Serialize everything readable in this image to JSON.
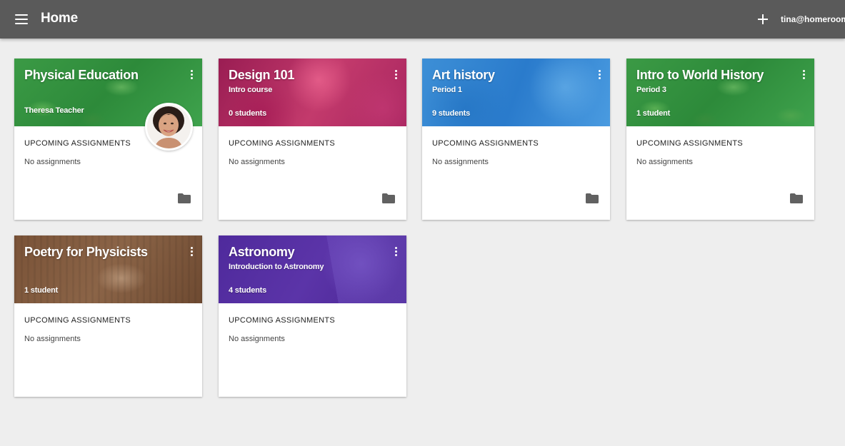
{
  "header": {
    "title": "Home",
    "user_email": "tina@homerooma",
    "menu_icon": "hamburger-menu-icon",
    "add_icon": "plus-icon"
  },
  "section_label": "UPCOMING ASSIGNMENTS",
  "empty_label": "No assignments",
  "classes": [
    {
      "title": "Physical Education",
      "subtitle": "",
      "footer": "Theresa Teacher",
      "theme": "green",
      "has_avatar": true
    },
    {
      "title": "Design 101",
      "subtitle": "Intro course",
      "footer": "0 students",
      "theme": "magenta"
    },
    {
      "title": "Art history",
      "subtitle": "Period 1",
      "footer": "9 students",
      "theme": "blue"
    },
    {
      "title": "Intro to World History",
      "subtitle": "Period 3",
      "footer": "1 student",
      "theme": "green"
    },
    {
      "title": "Poetry for Physicists",
      "subtitle": "",
      "footer": "1 student",
      "theme": "brown"
    },
    {
      "title": "Astronomy",
      "subtitle": "Introduction to Astronomy",
      "footer": "4 students",
      "theme": "purple"
    }
  ],
  "colors": {
    "topbar": "#5a5a5a",
    "background": "#eeeeee",
    "green": "#3b9a45",
    "magenta": "#b22b63",
    "blue": "#2f82d0",
    "brown": "#7d5639",
    "purple": "#5330a2"
  }
}
